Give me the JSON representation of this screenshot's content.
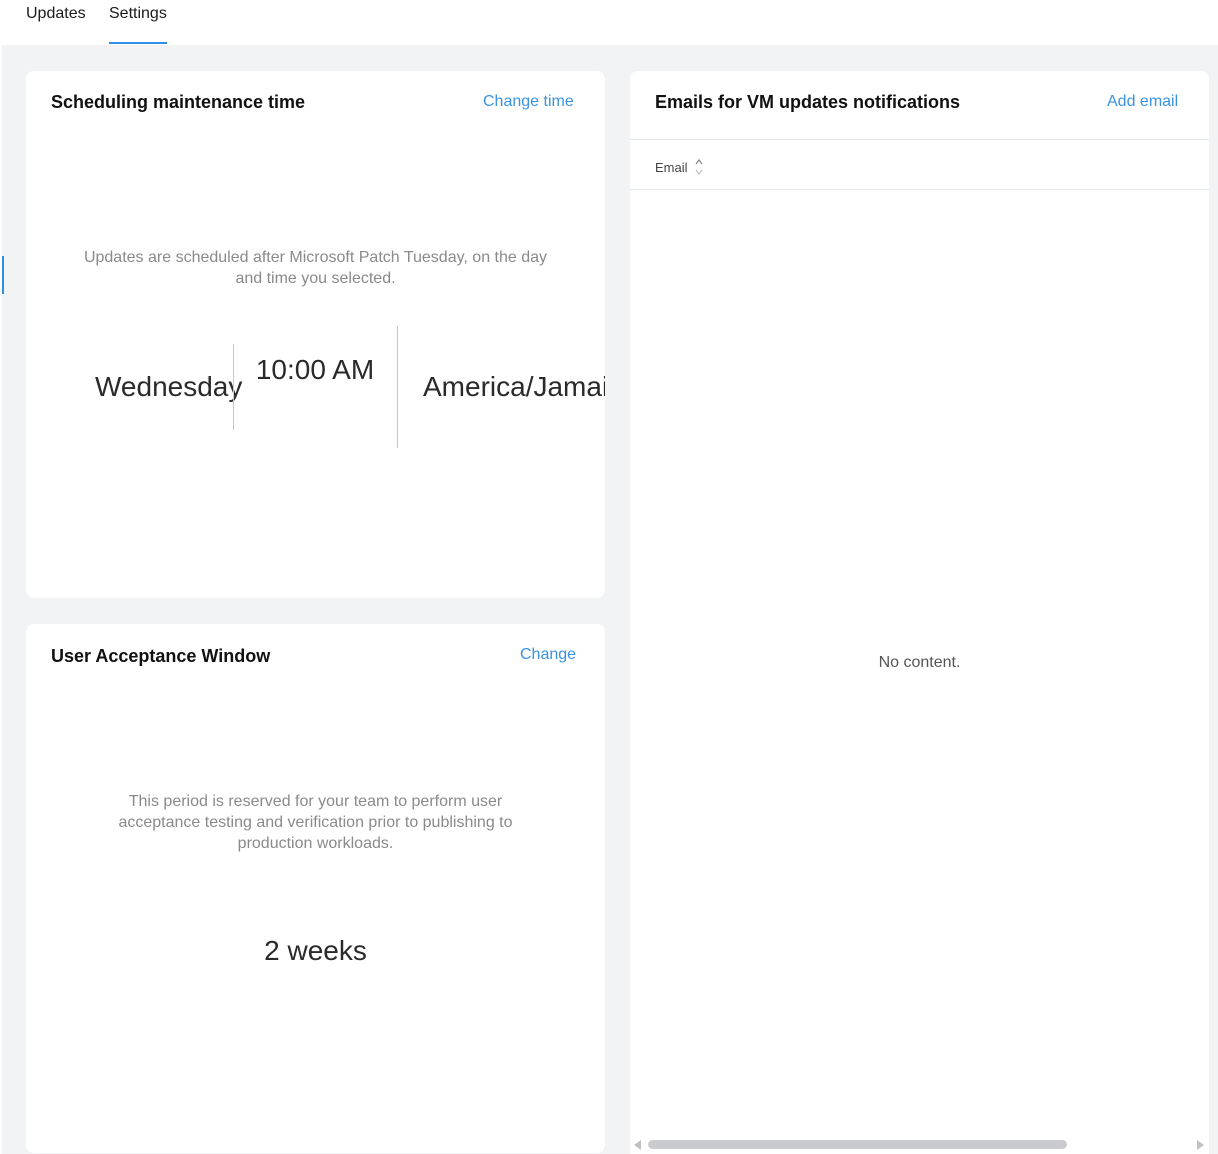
{
  "tabs": [
    {
      "label": "Updates",
      "active": false
    },
    {
      "label": "Settings",
      "active": true
    }
  ],
  "colors": {
    "accent": "#2d8fe6",
    "link": "#3a93e2",
    "background": "#f2f3f5",
    "card": "#ffffff"
  },
  "maintenance": {
    "title": "Scheduling maintenance time",
    "action": "Change time",
    "description": "Updates are scheduled after Microsoft Patch Tuesday, on the day and time you selected.",
    "day": "Wednesday",
    "time": "10:00 AM",
    "timezone": "America/Jamaica"
  },
  "acceptance": {
    "title": "User Acceptance Window",
    "action": "Change",
    "description": "This period is reserved for your team to perform user acceptance testing and verification prior to publishing to production workloads.",
    "duration": "2 weeks"
  },
  "emails": {
    "title": "Emails for VM updates notifications",
    "action": "Add email",
    "columns": [
      "Email"
    ],
    "sort_icon": "sort-icon",
    "empty_text": "No content."
  }
}
